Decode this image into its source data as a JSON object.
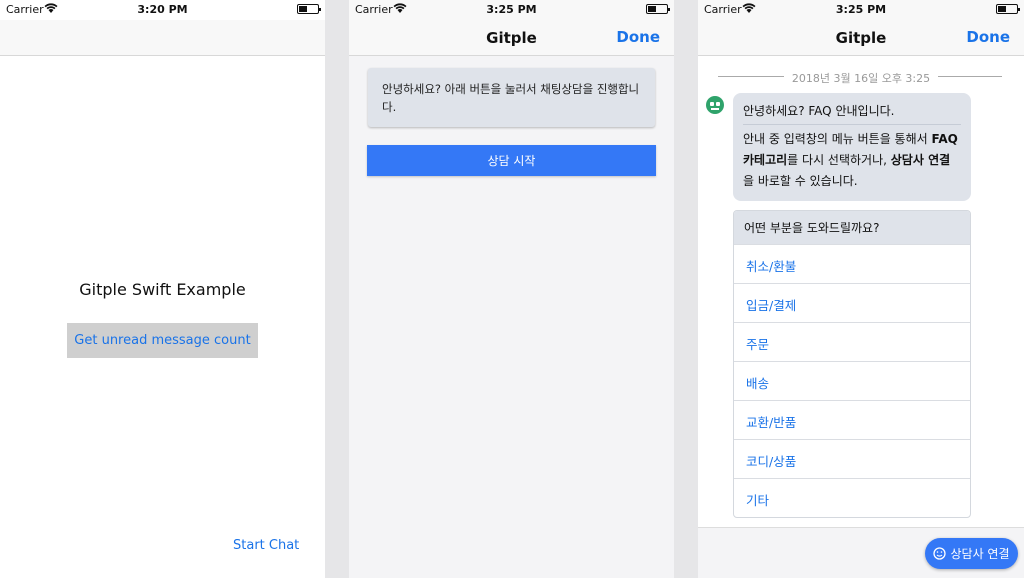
{
  "screen1": {
    "status": {
      "carrier": "Carrier",
      "time": "3:20 PM"
    },
    "title": "Gitple Swift Example",
    "unread_button": "Get unread message count",
    "start_chat": "Start Chat"
  },
  "screen2": {
    "status": {
      "carrier": "Carrier",
      "time": "3:25 PM"
    },
    "nav_title": "Gitple",
    "done": "Done",
    "greeting": "안녕하세요? 아래 버튼을 눌러서 채팅상담을 진행합니다.",
    "start_button": "상담 시작"
  },
  "screen3": {
    "status": {
      "carrier": "Carrier",
      "time": "3:25 PM"
    },
    "nav_title": "Gitple",
    "done": "Done",
    "date": "2018년 3월 16일 오후 3:25",
    "bubble": {
      "title": "안녕하세요? FAQ 안내입니다.",
      "body_1": "안내 중 입력창의 메뉴 버튼을 통해서 ",
      "bold_1": "FAQ 카테고리",
      "body_2": "를 다시 선택하거나, ",
      "bold_2": "상담사 연결",
      "body_3": "을 바로할 수 있습니다."
    },
    "faq": {
      "question": "어떤 부분을 도와드릴까요?",
      "options": [
        "취소/환불",
        "입금/결제",
        "주문",
        "배송",
        "교환/반품",
        "코디/상품",
        "기타"
      ]
    },
    "connect_button": "상담사 연결"
  },
  "colors": {
    "accent": "#1a73e8",
    "button_blue": "#3478f6",
    "bubble_bg": "#dfe3ea",
    "bot_green": "#2fa36b"
  },
  "icons": [
    "wifi-icon",
    "battery-icon",
    "bot-avatar-icon",
    "smile-icon"
  ]
}
